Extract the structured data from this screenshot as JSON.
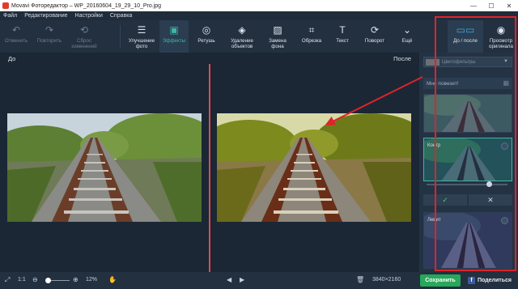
{
  "window": {
    "title": "Movavi Фоторедактор – WP_20160604_19_29_10_Pro.jpg",
    "controls": {
      "minimize": "—",
      "maximize": "☐",
      "close": "✕"
    }
  },
  "menu": [
    "Файл",
    "Редактирование",
    "Настройки",
    "Справка"
  ],
  "toolbar": {
    "undo": "Отменить",
    "redo": "Повторить",
    "reset": "Сброс изменений",
    "enhance": "Улучшение фото",
    "effects": "Эффекты",
    "retouch": "Ретушь",
    "remove_objects": "Удаление объектов",
    "replace_bg": "Замена фона",
    "crop": "Обрезка",
    "text": "Текст",
    "rotate": "Поворот",
    "more": "Ещё",
    "before_after": "До / после",
    "view_original": "Просмотр оригинала"
  },
  "view": {
    "before_label": "До",
    "after_label": "После"
  },
  "panel": {
    "filter_dropdown": "Цветофильтры",
    "feedback": "Мне повезет!",
    "thumb_caption_selected": "Контр",
    "thumb_caption_bottom": "Левит"
  },
  "bottom": {
    "ratio": "1:1",
    "zoom_percent": "12%",
    "resolution": "3840×2160",
    "save": "Сохранить",
    "share": "Поделиться"
  },
  "zoom_level": 0.12,
  "colors": {
    "accent": "#3fb5a6",
    "highlight_red": "#e0232b",
    "save_green": "#27a85a"
  }
}
